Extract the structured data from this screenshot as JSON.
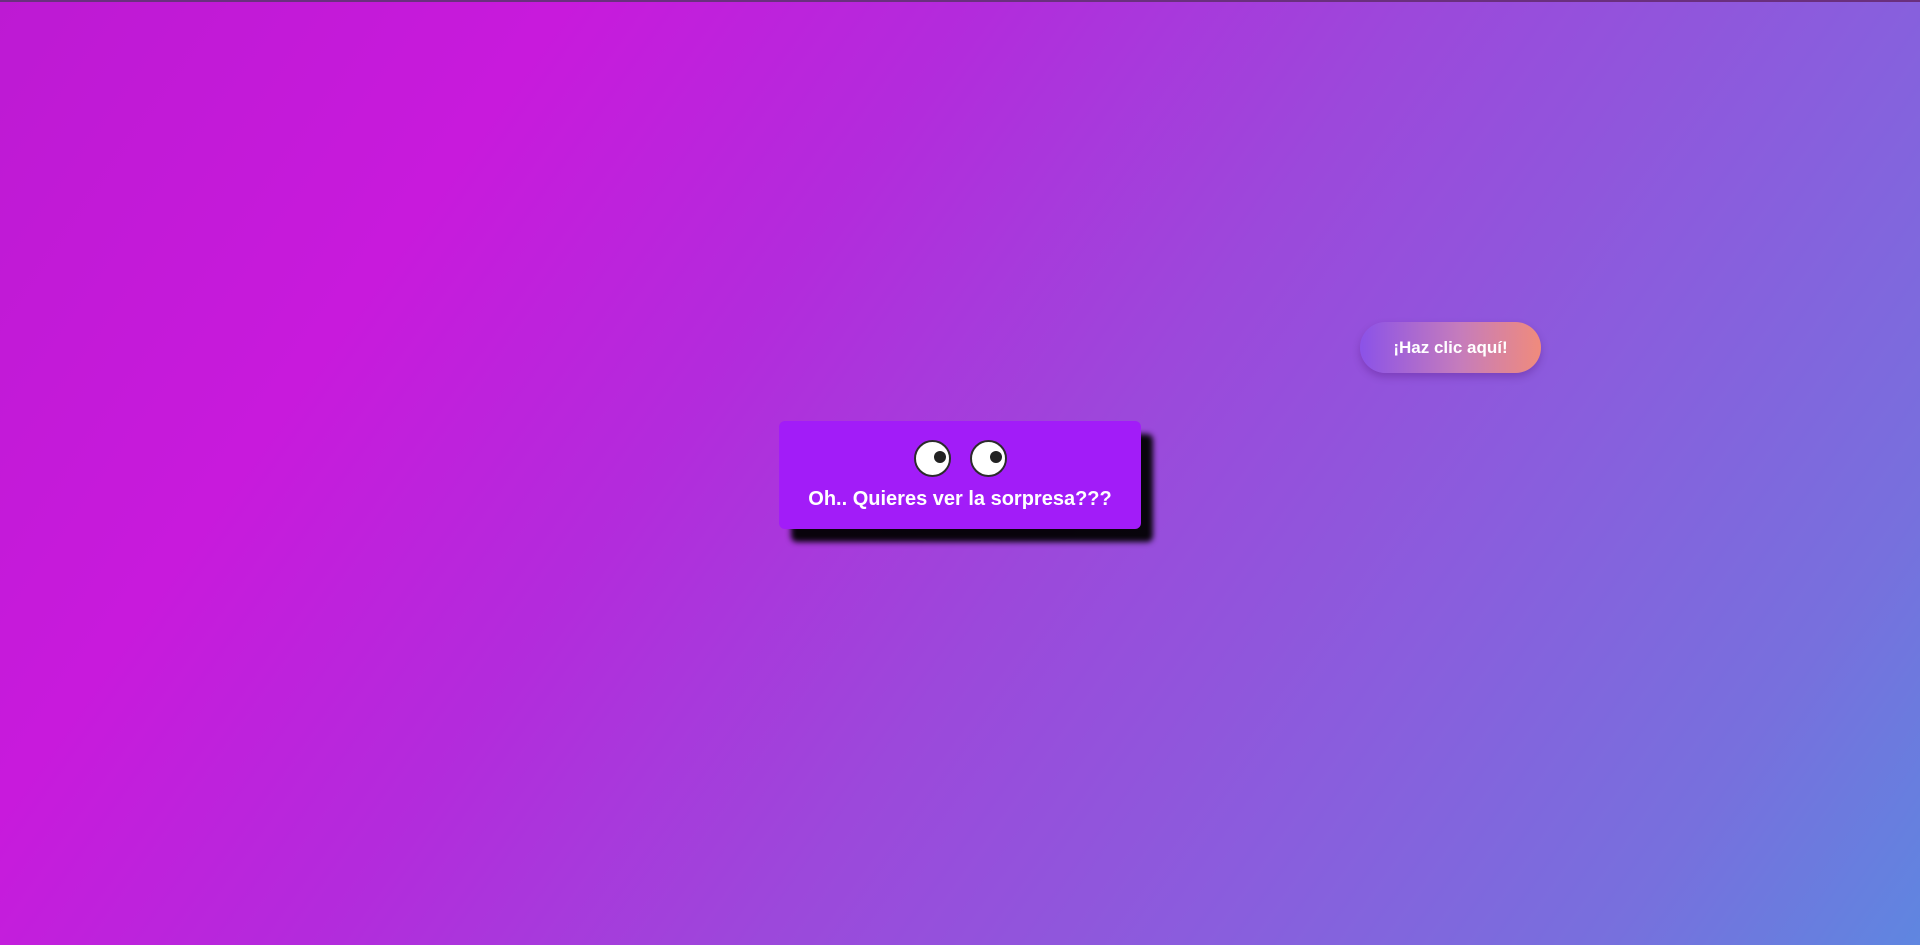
{
  "colors": {
    "background_start": "#bd1ad3",
    "background_end": "#5f86e0",
    "card_background": "#a21cf8",
    "button_gradient_start": "#8b52e8",
    "button_gradient_end": "#f08b7c",
    "text": "#ffffff"
  },
  "card": {
    "icons": [
      "eye-icon",
      "eye-icon"
    ],
    "message": "Oh.. Quieres ver la sorpresa???"
  },
  "cta_button": {
    "label": "¡Haz clic aquí!"
  }
}
